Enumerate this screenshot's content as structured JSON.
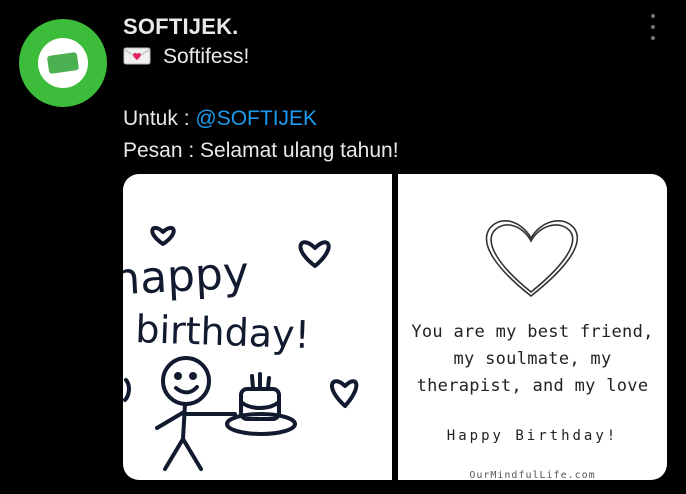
{
  "tweet": {
    "author_name": "SOFTIJEK.",
    "title": "Softifess!",
    "line_to_label": "Untuk : ",
    "mention": "@SOFTIJEK",
    "line_message": "Pesan : Selamat ulang tahun!",
    "avatar_icon": "softijek-logo",
    "envelope_icon": "love-letter-icon",
    "menu_icon": "more-vertical-icon"
  },
  "media": {
    "left_image": {
      "drawing_text": "happy birthday!"
    },
    "right_image": {
      "line1": "You are my best friend,",
      "line2": "my soulmate, my",
      "line3": "therapist, and my love",
      "line4": "Happy Birthday!",
      "watermark": "OurMindfulLife.com"
    }
  },
  "colors": {
    "background": "#000000",
    "text": "#e7e9ea",
    "mention": "#1d9bf0",
    "avatar_ring": "#3dbb3a"
  }
}
